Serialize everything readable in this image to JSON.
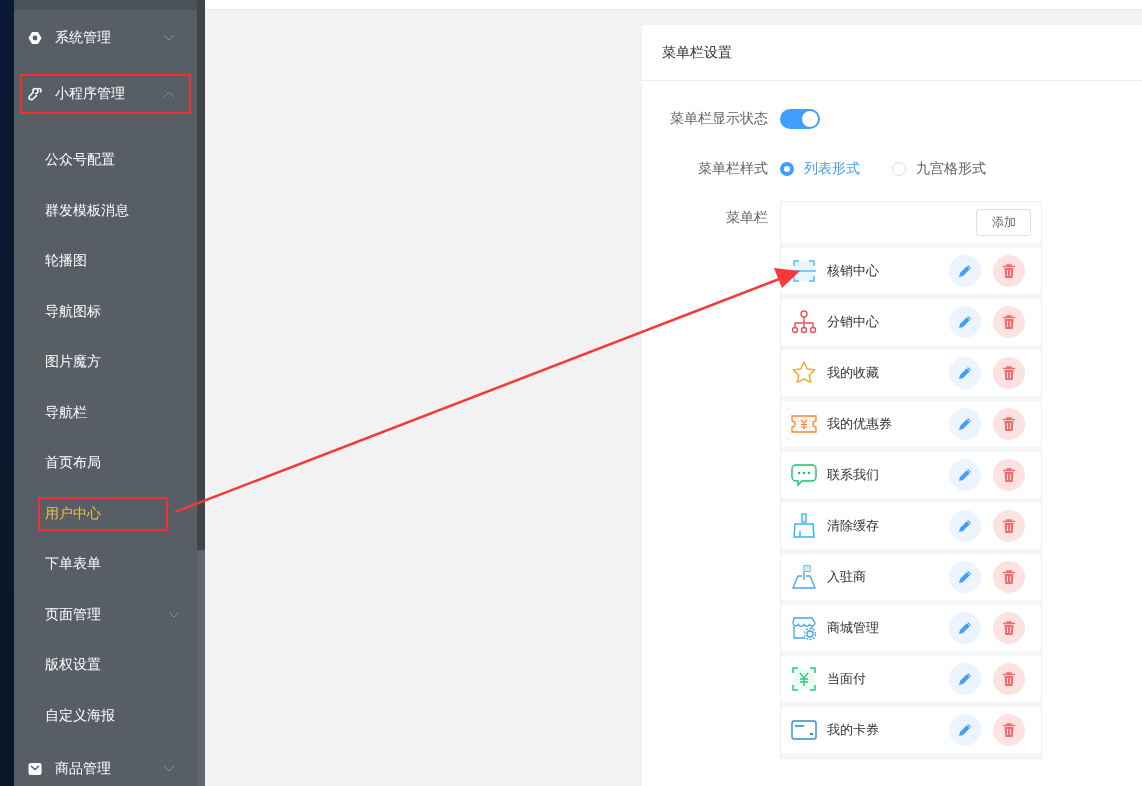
{
  "sidebar": {
    "items": [
      {
        "label": "系统管理",
        "kind": "gear",
        "expanded": false,
        "boxed": false
      },
      {
        "label": "小程序管理",
        "kind": "link",
        "expanded": true,
        "boxed": true,
        "children": [
          {
            "label": "公众号配置",
            "kind": "link",
            "selected": false,
            "boxed": false
          },
          {
            "label": "群发模板消息",
            "kind": "link",
            "selected": false,
            "boxed": false
          },
          {
            "label": "轮播图",
            "kind": "link",
            "selected": false,
            "boxed": false
          },
          {
            "label": "导航图标",
            "kind": "link",
            "selected": false,
            "boxed": false
          },
          {
            "label": "图片魔方",
            "kind": "link",
            "selected": false,
            "boxed": false
          },
          {
            "label": "导航栏",
            "kind": "link",
            "selected": false,
            "boxed": false
          },
          {
            "label": "首页布局",
            "kind": "link",
            "selected": false,
            "boxed": false
          },
          {
            "label": "用户中心",
            "kind": "link",
            "selected": true,
            "boxed": true
          },
          {
            "label": "下单表单",
            "kind": "link",
            "selected": false,
            "boxed": false
          },
          {
            "label": "页面管理",
            "kind": "submenu",
            "selected": false,
            "boxed": false
          },
          {
            "label": "版权设置",
            "kind": "link",
            "selected": false,
            "boxed": false
          },
          {
            "label": "自定义海报",
            "kind": "link",
            "selected": false,
            "boxed": false
          }
        ]
      },
      {
        "label": "商品管理",
        "kind": "mail",
        "expanded": false,
        "boxed": false
      }
    ]
  },
  "card": {
    "title": "菜单栏设置",
    "toggle": {
      "label": "菜单栏显示状态",
      "on": true
    },
    "style": {
      "label": "菜单栏样式",
      "options": [
        {
          "label": "列表形式",
          "selected": true
        },
        {
          "label": "九宫格形式",
          "selected": false
        }
      ]
    },
    "menu": {
      "label": "菜单栏",
      "add_button": "添加",
      "items": [
        {
          "label": "核销中心",
          "kind": "scan"
        },
        {
          "label": "分销中心",
          "kind": "org"
        },
        {
          "label": "我的收藏",
          "kind": "star"
        },
        {
          "label": "我的优惠券",
          "kind": "coupon"
        },
        {
          "label": "联系我们",
          "kind": "chat"
        },
        {
          "label": "清除缓存",
          "kind": "broom"
        },
        {
          "label": "入驻商",
          "kind": "flag"
        },
        {
          "label": "商城管理",
          "kind": "store"
        },
        {
          "label": "当面付",
          "kind": "pay"
        },
        {
          "label": "我的卡券",
          "kind": "card"
        }
      ]
    }
  }
}
